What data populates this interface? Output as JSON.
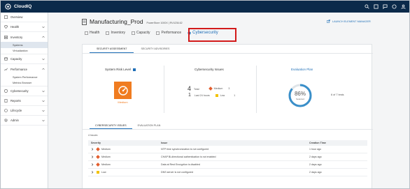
{
  "app": {
    "name": "CloudIQ",
    "brand_color": "#0b2a4a",
    "accent": "#1f6fb7"
  },
  "topbar": {
    "icons": [
      "search-icon",
      "notification-icon",
      "chat-icon",
      "help-icon",
      "user-icon"
    ]
  },
  "sidebar": {
    "items": [
      {
        "label": "Overview",
        "icon": "home-icon"
      },
      {
        "label": "Health",
        "icon": "health-icon"
      },
      {
        "label": "Inventory",
        "icon": "inventory-icon"
      },
      {
        "label": "Capacity",
        "icon": "capacity-icon"
      },
      {
        "label": "Performance",
        "icon": "performance-icon"
      },
      {
        "label": "Cybersecurity",
        "icon": "shield-icon"
      },
      {
        "label": "Reports",
        "icon": "reports-icon"
      },
      {
        "label": "Lifecycle",
        "icon": "lifecycle-icon"
      },
      {
        "label": "Admin",
        "icon": "gear-icon"
      }
    ],
    "inventory_sub": [
      "Systems",
      "Virtualization"
    ],
    "performance_sub": [
      "System Performance",
      "Metrics Browser"
    ]
  },
  "header": {
    "title": "Manufacturing_Prod",
    "subtitle": "PowerStore 1000X | RV4236.62",
    "launch": "LAUNCH ELEMENT MANAGER"
  },
  "tabs": [
    "Health",
    "Inventory",
    "Capacity",
    "Performance",
    "Cybersecurity"
  ],
  "selected_tab": "Cybersecurity",
  "subtabs": [
    "SECURITY ASSESSMENT",
    "SECURITY ADVISORIES"
  ],
  "risk": {
    "label": "System Risk Level",
    "value": "Medium",
    "color": "#f07c20"
  },
  "issues_summary": {
    "label": "Cybersecurity Issues",
    "total": "4",
    "total_label": "Total",
    "last24": "1",
    "last24_label": "Last 24 hours",
    "medium_label": "Medium",
    "medium_count": "3",
    "low_label": "Low",
    "low_count": "1"
  },
  "evaluation": {
    "label": "Evaluation Plan",
    "percent": "86%",
    "percent_value": 0.86,
    "sub": "Selected",
    "count": "6 of 7 tests",
    "color": "#3a8fc9"
  },
  "subtabs2": [
    "CYBERSECURITY ISSUES",
    "EVALUATION PLAN"
  ],
  "table": {
    "count_label": "4 Issues",
    "headers": [
      "Severity",
      "Issue",
      "Creation Time"
    ],
    "rows": [
      {
        "severity": "Medium",
        "issue": "NTP time synchronization is not configured",
        "time": "1 hour ago"
      },
      {
        "severity": "Medium",
        "issue": "CHAP Bi-directional authentication is not enabled",
        "time": "2 days ago"
      },
      {
        "severity": "Medium",
        "issue": "Data at Rest Encryption is disabled",
        "time": "2 days ago"
      },
      {
        "severity": "Low",
        "issue": "DNS server is not configured",
        "time": "2 days ago"
      }
    ]
  }
}
